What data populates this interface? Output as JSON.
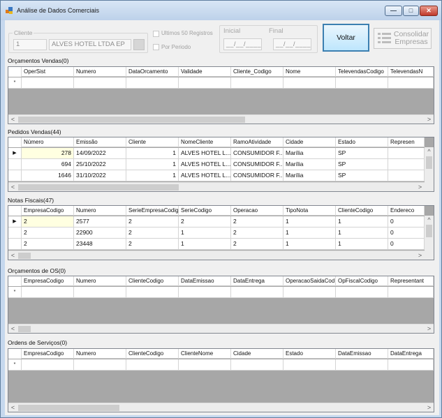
{
  "window": {
    "title": "Análise de Dados Comerciais",
    "minimize": "—",
    "maximize": "□",
    "close": "✕"
  },
  "top": {
    "cliente_label": "Cliente",
    "cliente_code": "1",
    "cliente_name": "ALVES HOTEL LTDA EP",
    "ultimos_label": "Ultimos 50 Registros",
    "periodo_label": "Por Periodo",
    "inicial_label": "Inicial",
    "final_label": "Final",
    "inicial_value": "__/__/____",
    "final_value": "__/__/____",
    "voltar_label": "Voltar",
    "consolidar_label": "Consolidar Empresas"
  },
  "grids": {
    "orcamentos": {
      "label": "Orçamentos Vendas(0)",
      "columns": [
        "OperSist",
        "Numero",
        "DataOrcamento",
        "Validade",
        "Cliente_Codigo",
        "Nome",
        "TelevendasCodigo",
        "TelevendasN"
      ],
      "new_row_marker": "*"
    },
    "pedidos": {
      "label": "Pedidos Vendas(44)",
      "columns": [
        "Número",
        "Emissão",
        "Cliente",
        "NomeCliente",
        "RamoAtividade",
        "Cidade",
        "Estado",
        "Represen"
      ],
      "current_row_marker": "▶",
      "rows": [
        [
          "278",
          "14/09/2022",
          "1",
          "ALVES HOTEL L...",
          "CONSUMIDOR F...",
          "Marília",
          "SP",
          ""
        ],
        [
          "694",
          "25/10/2022",
          "1",
          "ALVES HOTEL L...",
          "CONSUMIDOR F...",
          "Marília",
          "SP",
          ""
        ],
        [
          "1646",
          "31/10/2022",
          "1",
          "ALVES HOTEL L...",
          "CONSUMIDOR F...",
          "Marília",
          "SP",
          ""
        ]
      ]
    },
    "notas": {
      "label": "Notas Fiscais(47)",
      "columns": [
        "EmpresaCodigo",
        "Numero",
        "SerieEmpresaCodig",
        "SerieCodigo",
        "Operacao",
        "TipoNota",
        "ClienteCodigo",
        "Endereco"
      ],
      "current_row_marker": "▶",
      "rows": [
        [
          "2",
          "2577",
          "2",
          "2",
          "2",
          "1",
          "1",
          "0"
        ],
        [
          "2",
          "22900",
          "2",
          "1",
          "2",
          "1",
          "1",
          "0"
        ],
        [
          "2",
          "23448",
          "2",
          "1",
          "2",
          "1",
          "1",
          "0"
        ]
      ]
    },
    "os": {
      "label": "Orçamentos de OS(0)",
      "columns": [
        "EmpresaCodigo",
        "Numero",
        "ClienteCodigo",
        "DataEmissao",
        "DataEntrega",
        "OperacaoSaidaCod",
        "OpFiscalCodigo",
        "Representant"
      ],
      "new_row_marker": "*"
    },
    "ordens": {
      "label": "Ordens de Serviços(0)",
      "columns": [
        "EmpresaCodigo",
        "Numero",
        "ClienteCodigo",
        "ClienteNome",
        "Cidade",
        "Estado",
        "DataEmissao",
        "DataEntrega"
      ],
      "new_row_marker": "*"
    }
  },
  "scroll": {
    "left": "<",
    "right": ">",
    "up": "^",
    "down": "v"
  }
}
